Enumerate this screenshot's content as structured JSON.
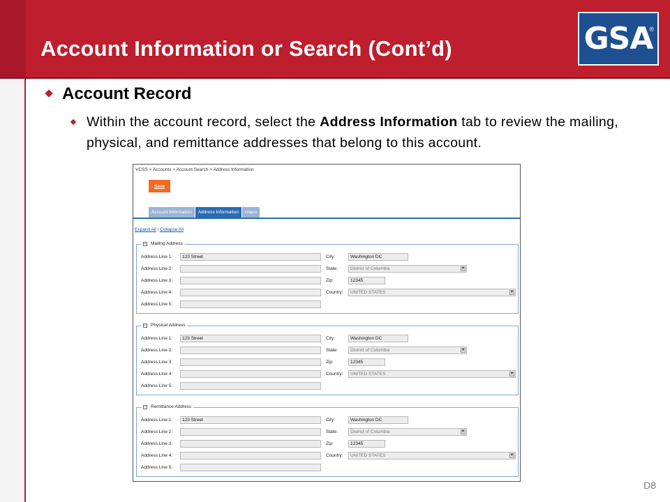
{
  "slide": {
    "title": "Account Information or Search (Cont’d)",
    "logo_text": "GSA",
    "logo_reg": "®",
    "heading": "Account Record",
    "body_before": "Within the account record, select the ",
    "body_bold": "Address Information",
    "body_after": " tab to review the mailing, physical, and remittance addresses that belong to this account.",
    "page_number": "D8",
    "colors": {
      "banner": "#be1e2d",
      "logo_bg": "#1d4f91",
      "accent": "#f26a21",
      "tab_active": "#2a6bb3"
    }
  },
  "screenshot": {
    "breadcrumb": "VCSS > Accounts > Account Search > Address Information",
    "save_label": "Save",
    "tabs": [
      "Account Information",
      "Address Information",
      "Users"
    ],
    "active_tab": "Address Information",
    "expand_all": "Expand All",
    "separator": "|",
    "collapse_all": "Collapse All",
    "field_labels": {
      "line1": "Address Line 1:",
      "line2": "Address Line 2:",
      "line3": "Address Line 3:",
      "line4": "Address Line 4:",
      "line5": "Address Line 5:",
      "city": "City:",
      "state": "State:",
      "zip": "Zip:",
      "country": "Country:"
    },
    "sections": [
      {
        "title": "Mailing Address",
        "line1": "123 Street",
        "line2": "",
        "line3": "",
        "line4": "",
        "line5": "",
        "city": "Washington DC",
        "state": "District of Columbia",
        "zip": "12345",
        "country": "UNITED STATES"
      },
      {
        "title": "Physical Address",
        "line1": "123 Street",
        "line2": "",
        "line3": "",
        "line4": "",
        "line5": "",
        "city": "Washington DC",
        "state": "District of Columbia",
        "zip": "12345",
        "country": "UNITED STATES"
      },
      {
        "title": "Remittance Address",
        "line1": "123 Street",
        "line2": "",
        "line3": "",
        "line4": "",
        "line5": "",
        "city": "Washington DC",
        "state": "District of Columbia",
        "zip": "12345",
        "country": "UNITED STATES"
      }
    ]
  }
}
